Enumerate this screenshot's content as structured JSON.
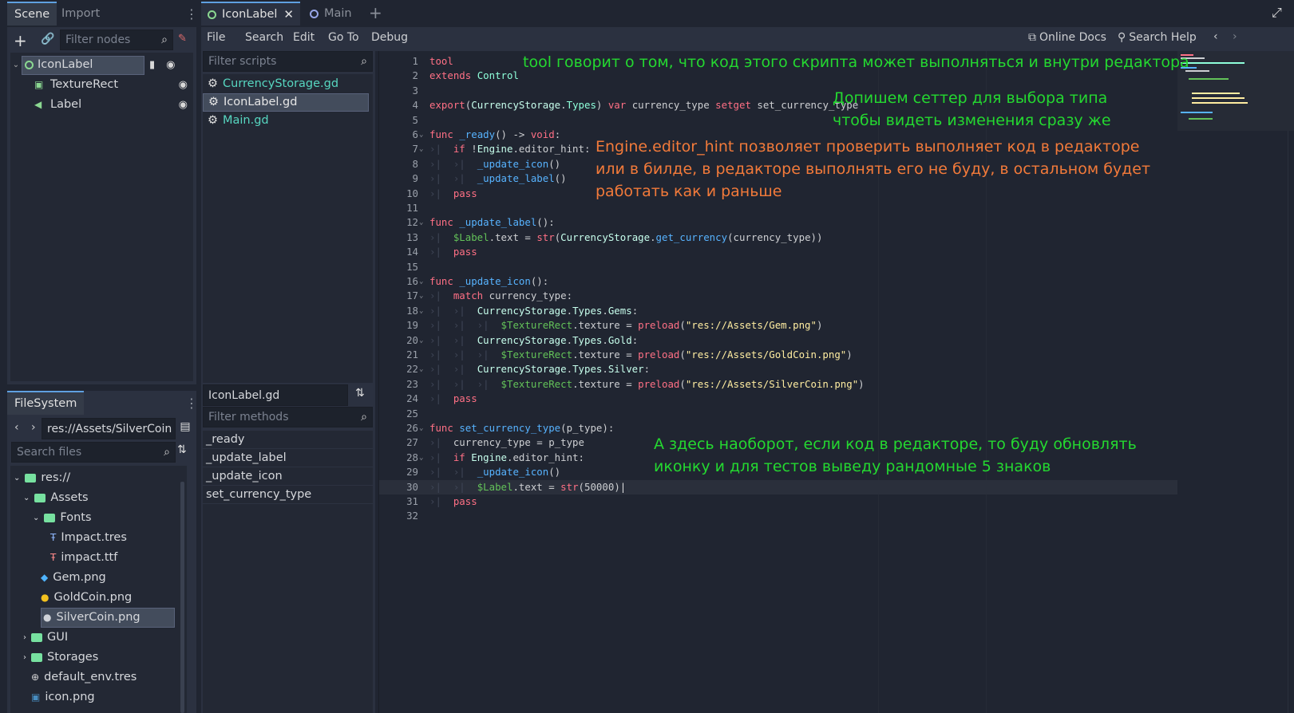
{
  "left_dock": {
    "tabs": [
      {
        "label": "Scene"
      },
      {
        "label": "Import"
      }
    ],
    "filter_nodes_placeholder": "Filter nodes",
    "nodes": [
      {
        "label": "IconLabel"
      },
      {
        "label": "TextureRect"
      },
      {
        "label": "Label"
      }
    ]
  },
  "filesystem": {
    "tab": "FileSystem",
    "path": "res://Assets/SilverCoin",
    "search_placeholder": "Search files",
    "items": [
      {
        "label": "res://"
      },
      {
        "label": "Assets"
      },
      {
        "label": "Fonts"
      },
      {
        "label": "Impact.tres"
      },
      {
        "label": "impact.ttf"
      },
      {
        "label": "Gem.png"
      },
      {
        "label": "GoldCoin.png"
      },
      {
        "label": "SilverCoin.png"
      },
      {
        "label": "GUI"
      },
      {
        "label": "Storages"
      },
      {
        "label": "default_env.tres"
      },
      {
        "label": "icon.png"
      }
    ]
  },
  "editor_tabs": [
    {
      "label": "IconLabel"
    },
    {
      "label": "Main"
    }
  ],
  "menu": [
    {
      "label": "File"
    },
    {
      "label": "Search"
    },
    {
      "label": "Edit"
    },
    {
      "label": "Go To"
    },
    {
      "label": "Debug"
    }
  ],
  "help": {
    "online_docs": "Online Docs",
    "search_help": "Search Help"
  },
  "scripts": {
    "filter_placeholder": "Filter scripts",
    "items": [
      {
        "label": "CurrencyStorage.gd"
      },
      {
        "label": "IconLabel.gd"
      },
      {
        "label": "Main.gd"
      }
    ],
    "current": "IconLabel.gd",
    "filter_methods_placeholder": "Filter methods",
    "methods": [
      {
        "label": "_ready"
      },
      {
        "label": "_update_label"
      },
      {
        "label": "_update_icon"
      },
      {
        "label": "set_currency_type"
      }
    ]
  },
  "code": {
    "l1": "tool",
    "l2a": "extends",
    "l2b": "Control",
    "l4a": "export",
    "l4b": "CurrencyStorage",
    "l4c": "Types",
    "l4d": "var",
    "l4e": "currency_type",
    "l4f": "setget",
    "l4g": "set_currency_type",
    "l6a": "func",
    "l6b": "_ready",
    "l6c": "void",
    "l7a": "if",
    "l7b": "Engine",
    "l7c": "editor_hint",
    "l8": "_update_icon",
    "l9": "_update_label",
    "l10": "pass",
    "l12a": "func",
    "l12b": "_update_label",
    "l13a": "$Label",
    "l13b": "text",
    "l13c": "str",
    "l13d": "CurrencyStorage",
    "l13e": "get_currency",
    "l13f": "currency_type",
    "l14": "pass",
    "l16a": "func",
    "l16b": "_update_icon",
    "l17a": "match",
    "l17b": "currency_type",
    "l18a": "CurrencyStorage",
    "l18b": "Types",
    "l18c": "Gems",
    "l19a": "$TextureRect",
    "l19b": "texture",
    "l19c": "preload",
    "l19d": "\"res://Assets/Gem.png\"",
    "l20a": "CurrencyStorage",
    "l20b": "Types",
    "l20c": "Gold",
    "l21a": "$TextureRect",
    "l21b": "texture",
    "l21c": "preload",
    "l21d": "\"res://Assets/GoldCoin.png\"",
    "l22a": "CurrencyStorage",
    "l22b": "Types",
    "l22c": "Silver",
    "l23a": "$TextureRect",
    "l23b": "texture",
    "l23c": "preload",
    "l23d": "\"res://Assets/SilverCoin.png\"",
    "l24": "pass",
    "l26a": "func",
    "l26b": "set_currency_type",
    "l26c": "p_type",
    "l27a": "currency_type",
    "l27b": "p_type",
    "l28a": "if",
    "l28b": "Engine",
    "l28c": "editor_hint",
    "l29": "_update_icon",
    "l30a": "$Label",
    "l30b": "text",
    "l30c": "str",
    "l30d": "50000",
    "l31": "pass"
  },
  "annotations": {
    "a1": "tool говорит о том, что код этого скрипта может выполняться и внутри редактора",
    "a2_1": "Допишем сеттер для выбора типа",
    "a2_2": "чтобы видеть изменения сразу же",
    "a3_1": "Engine.editor_hint позволяет проверить выполняет код в редакторе",
    "a3_2": "или в билде, в редакторе выполнять его не буду, в остальном будет",
    "a3_3": "работать как и раньше",
    "a4_1": "А здесь наоборот, если код в редакторе, то буду обновлять",
    "a4_2": "иконку и для тестов выведу рандомные 5 знаков"
  },
  "colors": {
    "green_note": "#24d830",
    "orange_note": "#f27a3a",
    "accent": "#5fa0e0"
  }
}
